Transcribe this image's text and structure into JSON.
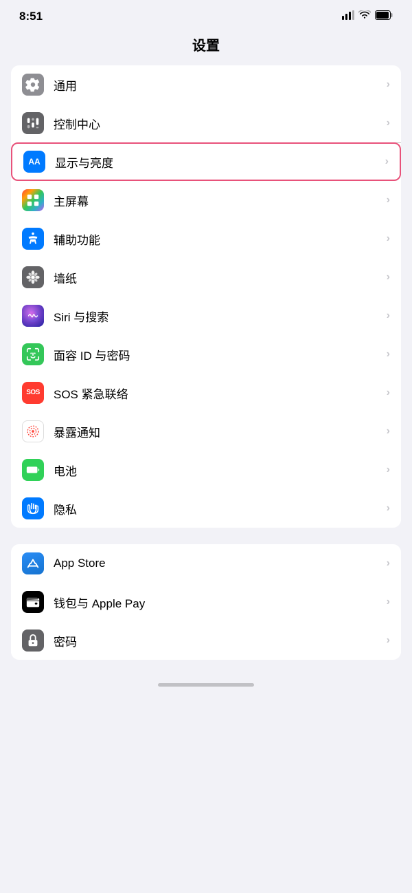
{
  "statusBar": {
    "time": "8:51",
    "signal": "signal",
    "wifi": "wifi",
    "battery": "battery"
  },
  "pageTitle": "设置",
  "sections": [
    {
      "id": "general",
      "items": [
        {
          "id": "general",
          "label": "通用",
          "icon": "gear",
          "bgClass": "icon-gray",
          "highlighted": false
        },
        {
          "id": "control-center",
          "label": "控制中心",
          "icon": "switches",
          "bgClass": "icon-gray2",
          "highlighted": false
        },
        {
          "id": "display",
          "label": "显示与亮度",
          "icon": "aa",
          "bgClass": "icon-blue",
          "highlighted": true
        },
        {
          "id": "home-screen",
          "label": "主屏幕",
          "icon": "grid",
          "bgClass": "icon-colorful",
          "highlighted": false
        },
        {
          "id": "accessibility",
          "label": "辅助功能",
          "icon": "accessibility",
          "bgClass": "icon-blue2",
          "highlighted": false
        },
        {
          "id": "wallpaper",
          "label": "墙纸",
          "icon": "flower",
          "bgClass": "icon-flower",
          "highlighted": false
        },
        {
          "id": "siri",
          "label": "Siri 与搜索",
          "icon": "siri",
          "bgClass": "icon-siri",
          "highlighted": false
        },
        {
          "id": "faceid",
          "label": "面容 ID 与密码",
          "icon": "faceid",
          "bgClass": "icon-green",
          "highlighted": false
        },
        {
          "id": "sos",
          "label": "SOS 紧急联络",
          "icon": "sos",
          "bgClass": "icon-red",
          "highlighted": false
        },
        {
          "id": "exposure",
          "label": "暴露通知",
          "icon": "exposure",
          "bgClass": "icon-pink-dot",
          "highlighted": false
        },
        {
          "id": "battery",
          "label": "电池",
          "icon": "battery2",
          "bgClass": "icon-green2",
          "highlighted": false
        },
        {
          "id": "privacy",
          "label": "隐私",
          "icon": "hand",
          "bgClass": "icon-blue3",
          "highlighted": false
        }
      ]
    },
    {
      "id": "apps",
      "items": [
        {
          "id": "appstore",
          "label": "App Store",
          "icon": "appstore",
          "bgClass": "icon-appstore",
          "highlighted": false
        },
        {
          "id": "wallet",
          "label": "钱包与 Apple Pay",
          "icon": "wallet",
          "bgClass": "icon-wallet",
          "highlighted": false
        },
        {
          "id": "passwords",
          "label": "密码",
          "icon": "password",
          "bgClass": "icon-password",
          "highlighted": false
        }
      ]
    }
  ]
}
